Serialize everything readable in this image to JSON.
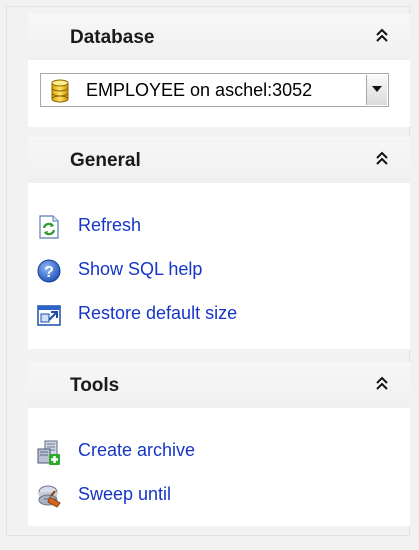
{
  "database_section": {
    "title": "Database",
    "selected_database": "EMPLOYEE on aschel:3052"
  },
  "general_section": {
    "title": "General",
    "links": [
      {
        "label": "Refresh",
        "icon": "refresh-icon"
      },
      {
        "label": "Show SQL help",
        "icon": "help-icon"
      },
      {
        "label": "Restore default size",
        "icon": "restore-size-icon"
      }
    ]
  },
  "tools_section": {
    "title": "Tools",
    "links": [
      {
        "label": "Create archive",
        "icon": "create-archive-icon"
      },
      {
        "label": "Sweep until",
        "icon": "sweep-icon"
      }
    ]
  },
  "colors": {
    "link": "#1535c8",
    "header_text": "#1a1a1a",
    "panel_bg": "#f2f2f2",
    "section_bg": "#ffffff"
  }
}
